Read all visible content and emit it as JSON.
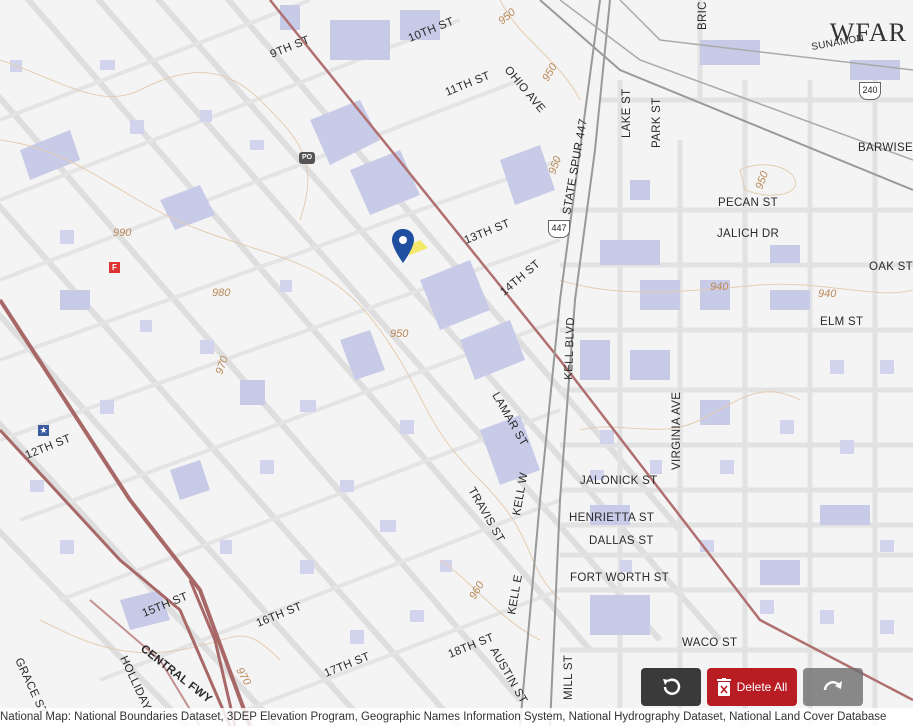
{
  "streets": {
    "s9th": "9TH ST",
    "s10th": "10TH ST",
    "s11th": "11TH ST",
    "s13th": "13TH ST",
    "s14th": "14TH ST",
    "s12th": "12TH ST",
    "s15th": "15TH ST",
    "s16th": "16TH ST",
    "s17th": "17TH ST",
    "s18th": "18TH ST",
    "ohio": "OHIO AVE",
    "spur": "STATE SPUR 447",
    "lake": "LAKE ST",
    "park": "PARK ST",
    "bric": "BRIC",
    "pecan": "PECAN ST",
    "jalich": "JALICH DR",
    "oak": "OAK ST",
    "elm": "ELM ST",
    "barwise": "BARWISE",
    "kellblvd": "KELL BLVD",
    "virginia": "VIRGINIA AVE",
    "lamar": "LAMAR ST",
    "kellw": "KELL W",
    "travis": "TRAVIS ST",
    "kelle": "KELL E",
    "jalonick": "JALONICK ST",
    "henrietta": "HENRIETTA ST",
    "dallas": "DALLAS ST",
    "fortworth": "FORT WORTH ST",
    "waco": "WACO ST",
    "central": "CENTRAL FWY",
    "austin": "AUSTIN ST",
    "mill": "MILL ST",
    "grace": "GRACE ST",
    "holliday": "HOLLIDAY",
    "sunamon": "SUNAMON"
  },
  "elevations": {
    "e950a": "950",
    "e950b": "950",
    "e950c": "950",
    "e990": "990",
    "e980": "980",
    "e970": "970",
    "e950d": "950",
    "e940a": "940",
    "e940b": "940",
    "e960": "960",
    "e970b": "970",
    "e950e": "950"
  },
  "shields": {
    "s447": "447",
    "s240": "240"
  },
  "poi": {
    "post": "PO",
    "fire": "F",
    "police": "★"
  },
  "logo": "WFAR",
  "toolbar": {
    "delete_label": "Delete All"
  },
  "attribution": "National Map: National Boundaries Dataset, 3DEP Elevation Program, Geographic Names Information System, National Hydrography Dataset, National Land Cover Database",
  "colors": {
    "building": "#c8cbe8",
    "major_road": "#b07070",
    "street": "#d9d9d9",
    "contour": "#d6b896",
    "delete": "#b81d24"
  }
}
